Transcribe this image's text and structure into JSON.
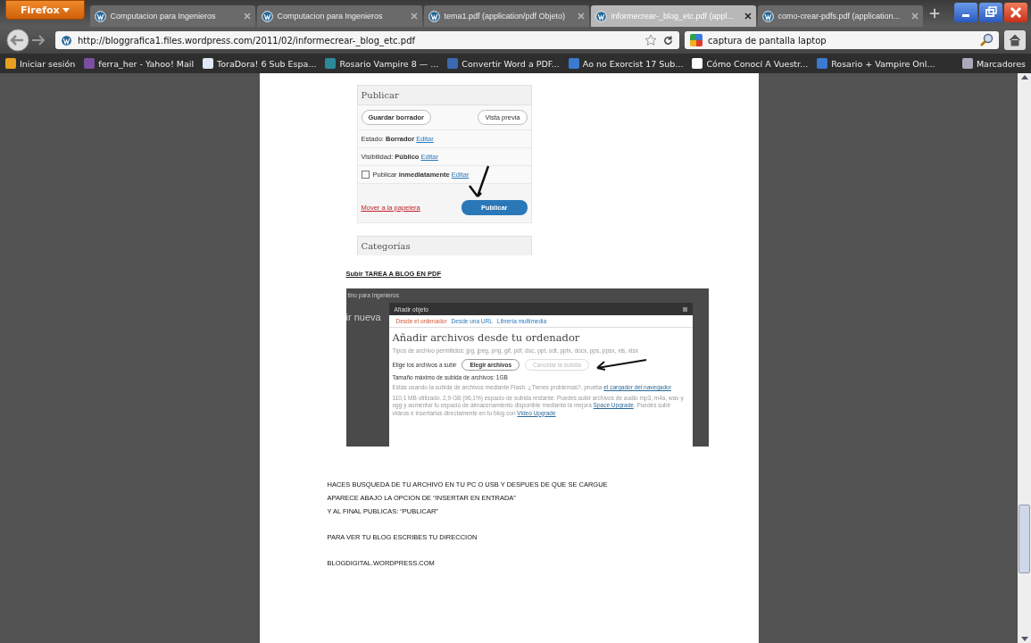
{
  "browser": {
    "menu_button": "Firefox",
    "tabs": [
      {
        "label": "Computacion para Ingenieros",
        "selected": false
      },
      {
        "label": "Computacion para Ingenieros",
        "selected": false
      },
      {
        "label": "tema1.pdf (application/pdf Objeto)",
        "selected": false
      },
      {
        "label": "informecrear-_blog_etc.pdf (appl...",
        "selected": true
      },
      {
        "label": "como-crear-pdfs.pdf (application...",
        "selected": false
      }
    ],
    "url": "http://bloggrafica1.files.wordpress.com/2011/02/informecrear-_blog_etc.pdf",
    "search": "captura de pantalla laptop",
    "bookmarks": [
      {
        "label": "Iniciar sesión",
        "kind": "windows"
      },
      {
        "label": "ferra_her - Yahoo! Mail",
        "kind": "mail"
      },
      {
        "label": "ToraDora! 6 Sub Espa...",
        "kind": "page"
      },
      {
        "label": "Rosario Vampire 8 — ...",
        "kind": "s"
      },
      {
        "label": "Convertir Word a PDF...",
        "kind": "doc"
      },
      {
        "label": "Ao no Exorcist 17 Sub...",
        "kind": "a"
      },
      {
        "label": "Cómo Conocí A Vuestr...",
        "kind": "sy"
      },
      {
        "label": "Rosario + Vampire Onl...",
        "kind": "a"
      }
    ],
    "bookmarks_menu": "Marcadores"
  },
  "document": {
    "publish_box": {
      "title": "Publicar",
      "draft_button": "Guardar borrador",
      "preview_button": "Vista previa",
      "status_label": "Estado:",
      "status_value": "Borrador",
      "visibility_label": "Visibilidad:",
      "visibility_value": "Público",
      "schedule_label": "Publicar",
      "schedule_value": "inmediatamente",
      "status_edit": "Editar",
      "visibility_edit": "Editar",
      "schedule_edit": "Editar",
      "trash_link": "Mover a la papelera",
      "publish_button": "Publicar",
      "categories": "Categorías"
    },
    "upload_heading": "Subir    TAREA A BLOG EN PDF",
    "upload_dialog": {
      "background_text": "tino para Ingenieros",
      "background_heading": "ir nueva",
      "title": "Añadir objeto",
      "tabs": [
        {
          "label": "Desde el ordenador",
          "selected": true
        },
        {
          "label": "Desde una URL",
          "selected": false
        },
        {
          "label": "Librería multimedia",
          "selected": false
        }
      ],
      "heading": "Añadir archivos desde tu ordenador",
      "allowed_types": "Tipos de archivo permitidos: jpg, jpeg, png, gif, pdf, doc, ppt, odt, pptx, docx, pps, ppsx, xls, xlsx",
      "choose_label": "Elige los archivos a subir",
      "choose_button": "Elegir archivos",
      "cancel_button": "Cancelar la subida",
      "max_size": "Tamaño máximo de subida de archivos: 1GB",
      "flash_note": "Estás usando la subida de archivos mediante Flash. ¿Tienes problemas?, prueba",
      "flash_link": "el cargador del navegador",
      "space_note": "110,1 MB utilizado. 2,9 GB (96,1%) espacio de subida restante. Puedes subir archivos de audio mp3, m4a, wav y ogg y aumentar tu espacio de almacenamiento disponible mediante la mejora",
      "space_link": "Space Upgrade",
      "video_note": ". Puedes subir videos e insertarlos directamente en tu blog con",
      "video_link": "Video Upgrade"
    },
    "paragraphs": [
      [
        "HACES BUSQUEDA DE TU ARCHIVO EN TU PC O USB Y DESPUES DE QUE SE CARGUE",
        "APARECE ABAJO LA OPCION DE “INSERTAR EN ENTRADA”",
        "Y AL FINAL PUBLICAS: “PUBLICAR”"
      ],
      [
        "PARA VER TU BLOG ESCRIBES  TU DIRECCION"
      ],
      [
        "BLOGDIGITAL.WORDPRESS.COM"
      ]
    ]
  }
}
